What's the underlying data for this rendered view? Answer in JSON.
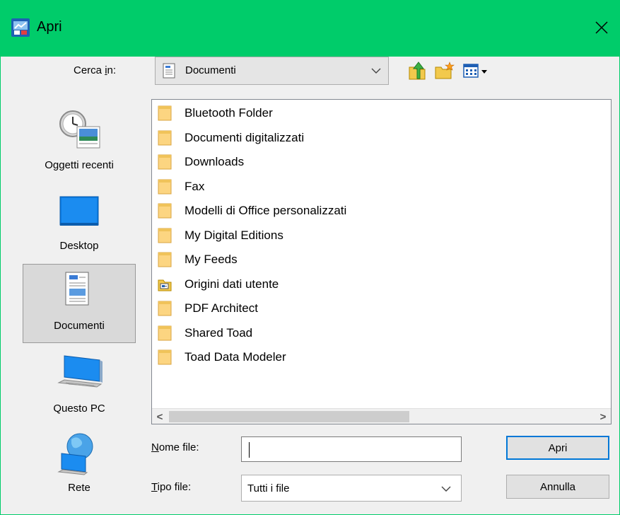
{
  "window": {
    "title": "Apri"
  },
  "lookin": {
    "label_prefix": "Cerca ",
    "label_accel": "i",
    "label_suffix": "n:",
    "value": "Documenti"
  },
  "places": [
    {
      "label": "Oggetti recenti",
      "icon": "recent-items-icon"
    },
    {
      "label": "Desktop",
      "icon": "desktop-icon"
    },
    {
      "label": "Documenti",
      "icon": "documents-icon",
      "selected": true
    },
    {
      "label": "Questo PC",
      "icon": "computer-icon"
    },
    {
      "label": "Rete",
      "icon": "network-icon"
    }
  ],
  "files": [
    {
      "name": "Bluetooth Folder",
      "icon": "folder-icon"
    },
    {
      "name": "Documenti digitalizzati",
      "icon": "folder-icon"
    },
    {
      "name": "Downloads",
      "icon": "folder-icon"
    },
    {
      "name": "Fax",
      "icon": "folder-icon"
    },
    {
      "name": "Modelli di Office personalizzati",
      "icon": "folder-icon"
    },
    {
      "name": "My Digital Editions",
      "icon": "folder-icon"
    },
    {
      "name": "My Feeds",
      "icon": "folder-icon"
    },
    {
      "name": "Origini dati utente",
      "icon": "special-folder-icon"
    },
    {
      "name": "PDF Architect",
      "icon": "folder-icon"
    },
    {
      "name": "Shared Toad",
      "icon": "folder-icon"
    },
    {
      "name": "Toad Data Modeler",
      "icon": "folder-icon"
    }
  ],
  "filename": {
    "label_accel": "N",
    "label_rest": "ome file:",
    "value": ""
  },
  "filetype": {
    "label_accel": "T",
    "label_rest": "ipo file:",
    "value": "Tutti i file"
  },
  "buttons": {
    "open": "Apri",
    "cancel": "Annulla"
  },
  "scroll": {
    "left": "<",
    "right": ">"
  }
}
